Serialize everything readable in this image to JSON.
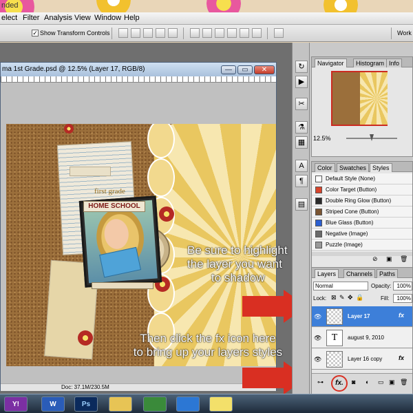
{
  "app": {
    "menu": [
      "elect",
      "Filter",
      "Analysis",
      "View",
      "Window",
      "Help"
    ],
    "partial_top_text": "nded",
    "options": {
      "show_transform_controls": "Show Transform Controls",
      "checkbox_mark": "✓",
      "workspace": "Work"
    }
  },
  "document": {
    "title": "ma 1st Grade.psd @ 12.5% (Layer 17, RGB/8)",
    "controls": {
      "minimize": "—",
      "maximize": "▭",
      "close": "✕"
    },
    "status": "Doc: 37.1M/230.5M",
    "page_text": {
      "first_grade": "first grade",
      "home_school": "HOME SCHOOL"
    }
  },
  "annotations": {
    "highlight": [
      "Be sure to highlight",
      "the layer you want",
      "to shadow"
    ],
    "fx": [
      "Then click the fx icon here",
      "to bring up your layers styles"
    ]
  },
  "navigator": {
    "tabs": [
      "Navigator",
      "Histogram",
      "Info"
    ],
    "zoom": "12.5%"
  },
  "styles_panel": {
    "tabs": [
      "Color",
      "Swatches",
      "Styles"
    ],
    "items": [
      {
        "label": "Default Style (None)",
        "color": "#ffffff"
      },
      {
        "label": "Color Target (Button)",
        "color": "#d8452c"
      },
      {
        "label": "Double Ring Glow (Button)",
        "color": "#2a2a2a"
      },
      {
        "label": "Striped Cone (Button)",
        "color": "#7b5532"
      },
      {
        "label": "Blue Glass (Button)",
        "color": "#2b5fd1"
      },
      {
        "label": "Negative (Image)",
        "color": "#6a6a6a"
      },
      {
        "label": "Puzzle (Image)",
        "color": "#9a9a9a"
      }
    ]
  },
  "layers_panel": {
    "tabs": [
      "Layers",
      "Channels",
      "Paths"
    ],
    "blend_mode": "Normal",
    "opacity_label": "Opacity:",
    "opacity": "100%",
    "lock_label": "Lock:",
    "fill_label": "Fill:",
    "fill": "100%",
    "layers": [
      {
        "name": "Layer 17",
        "selected": true,
        "type": "pixel",
        "fx": "fx"
      },
      {
        "name": "august 9, 2010",
        "selected": false,
        "type": "text",
        "glyph": "T"
      },
      {
        "name": "Layer 16 copy",
        "selected": false,
        "type": "pixel",
        "fx": "fx"
      }
    ],
    "footer_fx": "fx."
  },
  "taskbar": {
    "items": [
      {
        "label": "Y!",
        "icon": "yahoo-icon"
      },
      {
        "label": "W",
        "icon": "word-icon"
      },
      {
        "label": "Ps",
        "icon": "photoshop-icon"
      },
      {
        "label": "",
        "icon": "folder-icon"
      },
      {
        "label": "",
        "icon": "frog-icon"
      },
      {
        "label": "",
        "icon": "quicktime-icon"
      },
      {
        "label": "",
        "icon": "notes-icon"
      }
    ]
  },
  "colors": {
    "selection": "#3d7fd9",
    "annotation_arrow": "#d92f22",
    "ps_blue": "#0b2a5c"
  }
}
